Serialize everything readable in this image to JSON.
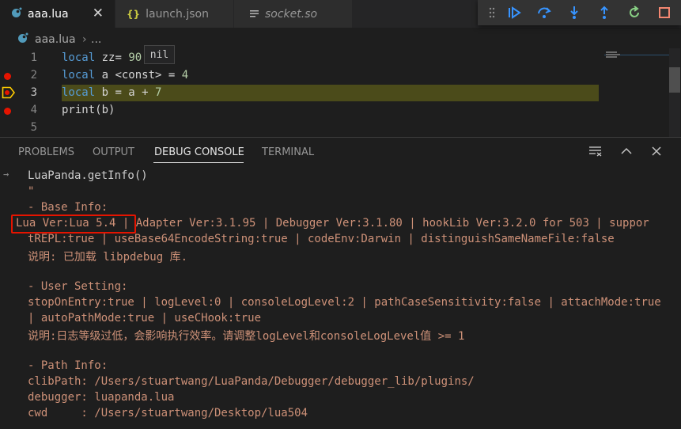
{
  "tabs": [
    {
      "label": "aaa.lua",
      "icon": "lua-file-icon"
    },
    {
      "label": "launch.json",
      "icon_text": "{}"
    },
    {
      "label": "socket.so",
      "icon": "file-lines-icon"
    }
  ],
  "breadcrumb": {
    "file": "aaa.lua",
    "more": "..."
  },
  "editor": {
    "line_numbers": [
      "1",
      "2",
      "3",
      "4",
      "5"
    ],
    "lines": {
      "l1": {
        "kw": "local",
        "rest": " zz= ",
        "num": "90"
      },
      "l2": {
        "kw": "local",
        "rest": " a <const> = ",
        "num": "4"
      },
      "l3": {
        "kw": "local",
        "rest": " b = a + ",
        "num": "7"
      },
      "l4": {
        "rest": "print(b)"
      }
    },
    "hover_value": "nil"
  },
  "panel": {
    "tabs": [
      "PROBLEMS",
      "OUTPUT",
      "DEBUG CONSOLE",
      "TERMINAL"
    ],
    "active_tab": "DEBUG CONSOLE"
  },
  "console": {
    "input_prompt": "→",
    "input": "LuaPanda.getInfo()",
    "lines": [
      "\"",
      "- Base Info:",
      "Lua Ver:Lua 5.4 | Adapter Ver:3.1.95 | Debugger Ver:3.1.80 | hookLib Ver:3.2.0 for 503 | suppor",
      "tREPL:true | useBase64EncodeString:true | codeEnv:Darwin | distinguishSameNameFile:false",
      "说明: 已加载 libpdebug 库.",
      "",
      "- User Setting:",
      "stopOnEntry:true | logLevel:0 | consoleLogLevel:2 | pathCaseSensitivity:false | attachMode:true",
      "| autoPathMode:true | useCHook:true",
      "说明:日志等级过低，会影响执行效率。请调整logLevel和consoleLogLevel值 >= 1",
      "",
      "- Path Info:",
      "clibPath: /Users/stuartwang/LuaPanda/Debugger/debugger_lib/plugins/",
      "debugger: luapanda.lua",
      "cwd     : /Users/stuartwang/Desktop/lua504"
    ]
  },
  "colors": {
    "accent": "#3794ff",
    "breakpoint": "#e51400",
    "current_line": "#4b4b1a",
    "restart": "#89d185",
    "stop": "#f48771",
    "lua_icon": "#519aba"
  }
}
